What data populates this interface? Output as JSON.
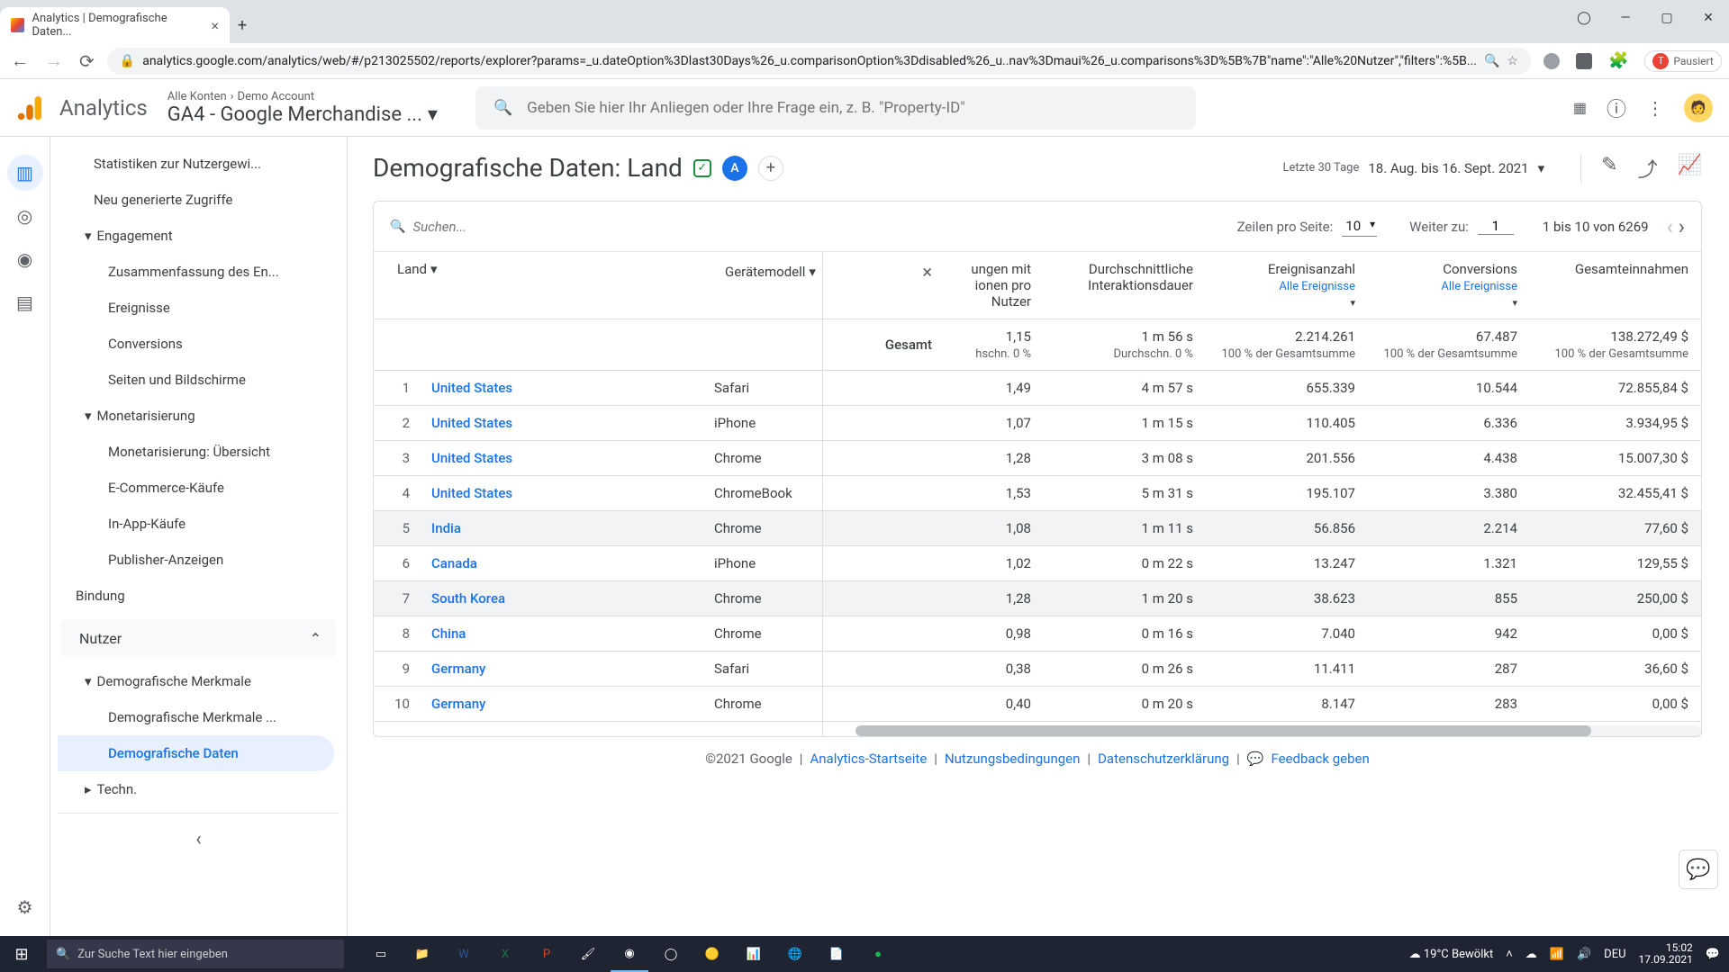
{
  "browser": {
    "tab_title": "Analytics | Demografische Daten...",
    "url": "analytics.google.com/analytics/web/#/p213025502/reports/explorer?params=_u.dateOption%3Dlast30Days%26_u.comparisonOption%3Ddisabled%26_u..nav%3Dmaui%26_u.comparisons%3D%5B%7B\"name\":\"Alle%20Nutzer\",\"filters\":%5B...",
    "paused": "Pausiert"
  },
  "appbar": {
    "brand": "Analytics",
    "breadcrumb1": "Alle Konten",
    "breadcrumb2": "Demo Account",
    "property": "GA4 - Google Merchandise ...",
    "search_placeholder": "Geben Sie hier Ihr Anliegen oder Ihre Frage ein, z. B. \"Property-ID\""
  },
  "sidebar": {
    "items_top": [
      "Statistiken zur Nutzergewi...",
      "Neu generierte Zugriffe"
    ],
    "engagement": "Engagement",
    "engagement_items": [
      "Zusammenfassung des En...",
      "Ereignisse",
      "Conversions",
      "Seiten und Bildschirme"
    ],
    "monet": "Monetarisierung",
    "monet_items": [
      "Monetarisierung: Übersicht",
      "E-Commerce-Käufe",
      "In-App-Käufe",
      "Publisher-Anzeigen"
    ],
    "bindung": "Bindung",
    "nutzer": "Nutzer",
    "demog": "Demografische Merkmale",
    "demog_items": [
      "Demografische Merkmale ...",
      "Demografische Daten"
    ],
    "techn": "Techn."
  },
  "report": {
    "title": "Demografische Daten: Land",
    "date_label": "Letzte 30 Tage",
    "date_range": "18. Aug. bis 16. Sept. 2021"
  },
  "table": {
    "search_placeholder": "Suchen...",
    "rows_label": "Zeilen pro Seite:",
    "rows_value": "10",
    "goto_label": "Weiter zu:",
    "goto_value": "1",
    "page_info": "1 bis 10 von 6269",
    "dim1": "Land",
    "dim2": "Gerätemodell",
    "headers": {
      "sess_per_user": "ungen mit ionen pro Nutzer",
      "avg_dur": "Durchschnittliche Interaktionsdauer",
      "events": "Ereignisanzahl",
      "events_sub": "Alle Ereignisse",
      "conv": "Conversions",
      "conv_sub": "Alle Ereignisse",
      "revenue": "Gesamteinnahmen"
    },
    "totals": {
      "label": "Gesamt",
      "sess_per_user": "1,15",
      "sess_sub": "hschn. 0 %",
      "avg_dur": "1 m 56 s",
      "dur_sub": "Durchschn. 0 %",
      "events": "2.214.261",
      "events_sub": "100 % der Gesamtsumme",
      "conv": "67.487",
      "conv_sub": "100 % der Gesamtsumme",
      "revenue": "138.272,49 $",
      "rev_sub": "100 % der Gesamtsumme"
    },
    "rows": [
      {
        "idx": "1",
        "country": "United States",
        "device": "Safari",
        "spu": "1,49",
        "dur": "4 m 57 s",
        "events": "655.339",
        "conv": "10.544",
        "rev": "72.855,84 $"
      },
      {
        "idx": "2",
        "country": "United States",
        "device": "iPhone",
        "spu": "1,07",
        "dur": "1 m 15 s",
        "events": "110.405",
        "conv": "6.336",
        "rev": "3.934,95 $"
      },
      {
        "idx": "3",
        "country": "United States",
        "device": "Chrome",
        "spu": "1,28",
        "dur": "3 m 08 s",
        "events": "201.556",
        "conv": "4.438",
        "rev": "15.007,30 $"
      },
      {
        "idx": "4",
        "country": "United States",
        "device": "ChromeBook",
        "spu": "1,53",
        "dur": "5 m 31 s",
        "events": "195.107",
        "conv": "3.380",
        "rev": "32.455,41 $"
      },
      {
        "idx": "5",
        "country": "India",
        "device": "Chrome",
        "spu": "1,08",
        "dur": "1 m 11 s",
        "events": "56.856",
        "conv": "2.214",
        "rev": "77,60 $"
      },
      {
        "idx": "6",
        "country": "Canada",
        "device": "iPhone",
        "spu": "1,02",
        "dur": "0 m 22 s",
        "events": "13.247",
        "conv": "1.321",
        "rev": "129,55 $"
      },
      {
        "idx": "7",
        "country": "South Korea",
        "device": "Chrome",
        "spu": "1,28",
        "dur": "1 m 20 s",
        "events": "38.623",
        "conv": "855",
        "rev": "250,00 $"
      },
      {
        "idx": "8",
        "country": "China",
        "device": "Chrome",
        "spu": "0,98",
        "dur": "0 m 16 s",
        "events": "7.040",
        "conv": "942",
        "rev": "0,00 $"
      },
      {
        "idx": "9",
        "country": "Germany",
        "device": "Safari",
        "spu": "0,38",
        "dur": "0 m 26 s",
        "events": "11.411",
        "conv": "287",
        "rev": "36,60 $"
      },
      {
        "idx": "10",
        "country": "Germany",
        "device": "Chrome",
        "spu": "0,40",
        "dur": "0 m 20 s",
        "events": "8.147",
        "conv": "283",
        "rev": "0,00 $"
      }
    ]
  },
  "footer": {
    "copyright": "©2021 Google",
    "links": [
      "Analytics-Startseite",
      "Nutzungsbedingungen",
      "Datenschutzerklärung"
    ],
    "feedback": "Feedback geben"
  },
  "taskbar": {
    "search": "Zur Suche Text hier eingeben",
    "weather_temp": "19°C",
    "weather_text": "Bewölkt",
    "lang": "DEU",
    "time": "15:02",
    "date": "17.09.2021"
  }
}
